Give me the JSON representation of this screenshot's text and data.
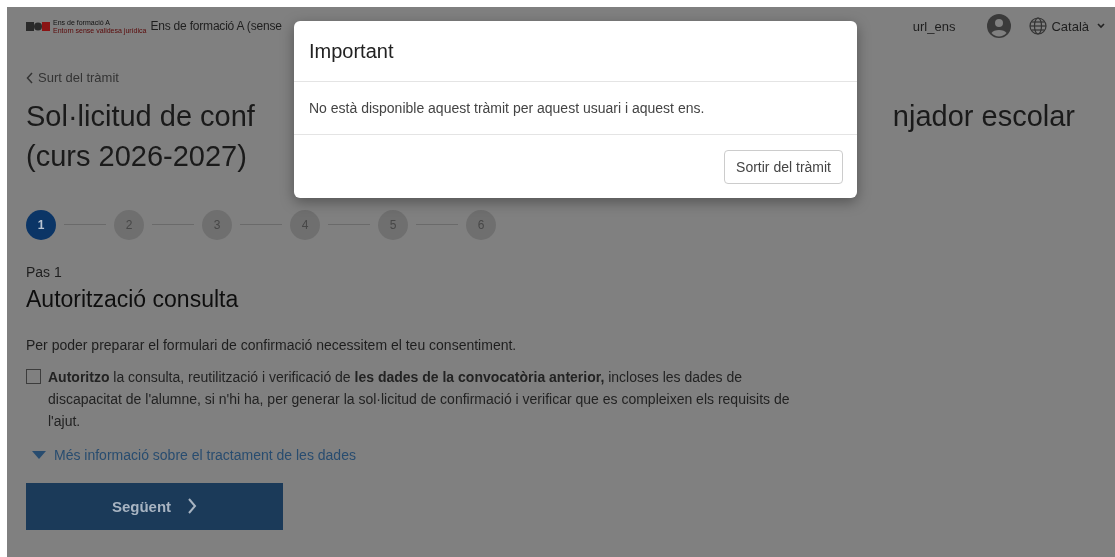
{
  "header": {
    "logo_title": "Ens de formació A",
    "logo_subtitle": "Entorn sense validesa jurídica",
    "organisation": "Ens de formació A (sense",
    "user": "url_ens",
    "language": "Català"
  },
  "back_link": "Surt del tràmit",
  "title": {
    "line_1_start": "Sol·licitud de conf",
    "line_1_end": "njador escolar",
    "line_2": "(curs 2026-2027)"
  },
  "steps": [
    {
      "label": "1",
      "selected": true
    },
    {
      "label": "2",
      "selected": false
    },
    {
      "label": "3",
      "selected": false
    },
    {
      "label": "4",
      "selected": false
    },
    {
      "label": "5",
      "selected": false
    },
    {
      "label": "6",
      "selected": false
    }
  ],
  "step_label": "Pas 1",
  "heading": "Autorització consulta",
  "intro": "Per poder preparar el formulari de confirmació necessitem el teu consentiment.",
  "consent": {
    "checked": false,
    "text": "**Autoritzo** la consulta, reutilització i verificació de **les dades de la convocatòria anterior,** incloses les dades de discapacitat de l'alumne, si n'hi ha, per generar la sol·licitud de confirmació i verificar que es compleixen els requisits de l'ajut."
  },
  "more_info": {
    "label": "Més informació sobre el tractament de les dades",
    "expanded": false
  },
  "next_button": "Següent",
  "modal": {
    "title": "Important",
    "message": "No està disponible aquest tràmit per aquest usuari i aquest ens.",
    "button": "Sortir del tràmit"
  }
}
